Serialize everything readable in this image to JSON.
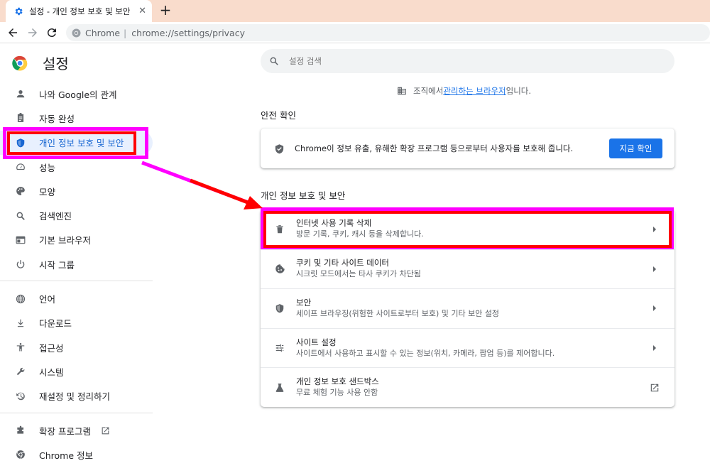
{
  "browser": {
    "tab_title": "설정 - 개인 정보 보호 및 보안",
    "tab_close": "✕",
    "new_tab": "+",
    "omnibox_site": "Chrome",
    "omnibox_sep": "|",
    "omnibox_url": "chrome://settings/privacy"
  },
  "header": {
    "title": "설정"
  },
  "search": {
    "placeholder": "설정 검색"
  },
  "managed": {
    "prefix": "조직에서 ",
    "link": "관리하는 브라우저",
    "suffix": "입니다."
  },
  "sidebar": {
    "items": [
      {
        "label": "나와 Google의 관계",
        "icon": "person-icon"
      },
      {
        "label": "자동 완성",
        "icon": "clipboard-icon"
      },
      {
        "label": "개인 정보 보호 및 보안",
        "icon": "shield-icon",
        "active": true
      },
      {
        "label": "성능",
        "icon": "speedometer-icon"
      },
      {
        "label": "모양",
        "icon": "palette-icon"
      },
      {
        "label": "검색엔진",
        "icon": "search-icon"
      },
      {
        "label": "기본 브라우저",
        "icon": "browser-window-icon"
      },
      {
        "label": "시작 그룹",
        "icon": "power-icon"
      },
      {
        "label": "언어",
        "icon": "globe-icon"
      },
      {
        "label": "다운로드",
        "icon": "download-icon"
      },
      {
        "label": "접근성",
        "icon": "accessibility-icon"
      },
      {
        "label": "시스템",
        "icon": "wrench-icon"
      },
      {
        "label": "재설정 및 정리하기",
        "icon": "history-icon"
      },
      {
        "label": "확장 프로그램",
        "icon": "puzzle-icon"
      },
      {
        "label": "Chrome 정보",
        "icon": "chrome-icon"
      }
    ]
  },
  "safety": {
    "title": "안전 확인",
    "text": "Chrome이 정보 유출, 유해한 확장 프로그램 등으로부터 사용자를 보호해 줍니다.",
    "button": "지금 확인"
  },
  "privacy": {
    "title": "개인 정보 보호 및 보안",
    "rows": [
      {
        "title": "인터넷 사용 기록 삭제",
        "subtitle": "방문 기록, 쿠키, 캐시 등을 삭제합니다.",
        "icon": "trash-icon"
      },
      {
        "title": "쿠키 및 기타 사이트 데이터",
        "subtitle": "시크릿 모드에서는 타사 쿠키가 차단됨",
        "icon": "cookie-icon"
      },
      {
        "title": "보안",
        "subtitle": "세이프 브라우징(위험한 사이트로부터 보호) 및 기타 보안 설정",
        "icon": "shield-icon"
      },
      {
        "title": "사이트 설정",
        "subtitle": "사이트에서 사용하고 표시할 수 있는 정보(위치, 카메라, 팝업 등)를 제어합니다.",
        "icon": "sliders-icon"
      },
      {
        "title": "개인 정보 보호 샌드박스",
        "subtitle": "무료 체험 기능 사용 안함",
        "icon": "flask-icon"
      }
    ]
  },
  "colors": {
    "accent": "#1a73e8",
    "highlight_pink": "#ff00ff",
    "highlight_red": "#ff0000",
    "tabbar": "#f9dccc"
  }
}
